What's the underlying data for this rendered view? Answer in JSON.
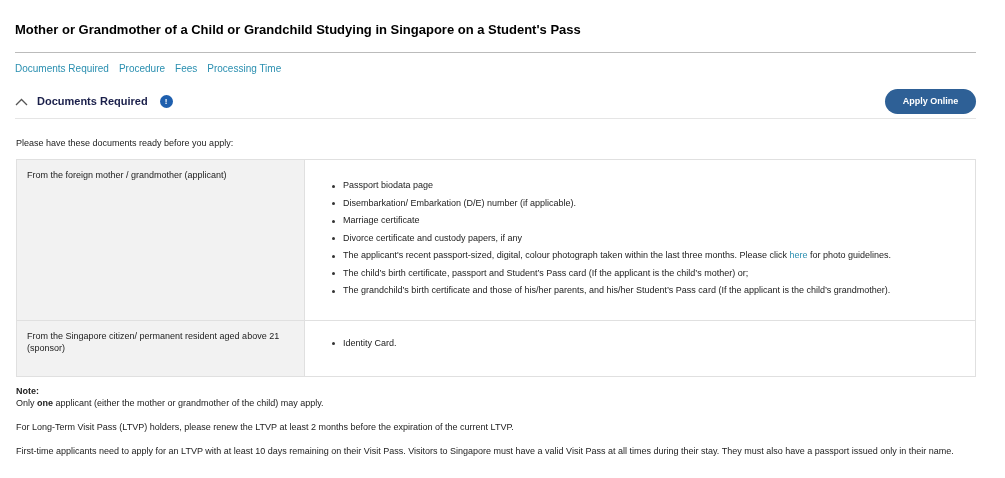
{
  "title": "Mother or Grandmother of a Child or Grandchild Studying in Singapore on a Student's Pass",
  "nav_links": [
    "Documents Required",
    "Procedure",
    "Fees",
    "Processing Time"
  ],
  "section": {
    "title": "Documents Required",
    "badge": "!",
    "expanded": true,
    "button": "Apply Online"
  },
  "intro": "Please have these documents ready before you apply:",
  "table": {
    "rows": [
      {
        "label": "From the foreign mother / grandmother (applicant)",
        "items": [
          {
            "text": "Passport biodata page"
          },
          {
            "text": "Disembarkation/ Embarkation (D/E) number (if applicable)."
          },
          {
            "text": "Marriage certificate"
          },
          {
            "text": "Divorce certificate and custody papers, if any"
          },
          {
            "text": "The applicant's recent passport-sized, digital, colour photograph taken within the last three months. Please click",
            "link": "here",
            "after": "for photo guidelines."
          },
          {
            "text": "The child’s birth certificate, passport and Student’s Pass card (If the applicant is the child’s mother) or;"
          },
          {
            "text": "The grandchild’s birth certificate and those of his/her parents, and his/her Student’s Pass card (If the applicant is the child’s grandmother)."
          }
        ]
      },
      {
        "label": "From the Singapore citizen/ permanent resident aged above 21 (sponsor)",
        "items": [
          {
            "text": "Identity Card."
          }
        ]
      }
    ]
  },
  "note": {
    "heading": "Note:",
    "paragraphs": [
      "Only **one** applicant (either the mother or grandmother of the child) may apply.",
      "For Long-Term Visit Pass (LTVP) holders, please renew the LTVP at least 2 months before the expiration of the current LTVP.",
      "First-time applicants need to apply for an LTVP with at least 10 days remaining on their Visit Pass. Visitors to Singapore must have a valid Visit Pass at all times during their stay. They must also have a passport issued only in their name."
    ]
  }
}
